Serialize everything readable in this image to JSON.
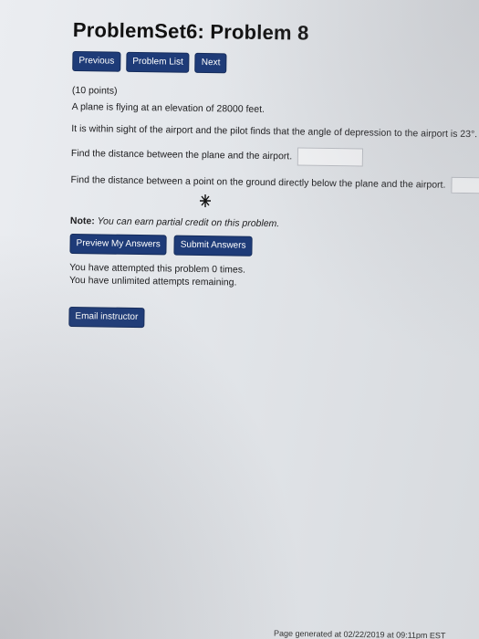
{
  "page": {
    "title": "ProblemSet6: Problem 8"
  },
  "nav": {
    "previous": "Previous",
    "problem_list": "Problem List",
    "next": "Next"
  },
  "problem": {
    "points": "(10 points)",
    "line1": "A plane is flying at an elevation of 28000 feet.",
    "line2": "It is within sight of the airport and the pilot finds that the angle of depression to the airport is 23°.",
    "q1": "Find the distance between the plane and the airport.",
    "q2": "Find the distance between a point on the ground directly below the plane and the airport."
  },
  "note": {
    "label": "Note:",
    "text": "You can earn partial credit on this problem."
  },
  "actions": {
    "preview": "Preview My Answers",
    "submit": "Submit Answers"
  },
  "attempts": {
    "line1": "You have attempted this problem 0 times.",
    "line2": "You have unlimited attempts remaining."
  },
  "email": {
    "label": "Email instructor"
  },
  "footer": {
    "text": "Page generated at 02/22/2019 at 09:11pm EST"
  }
}
